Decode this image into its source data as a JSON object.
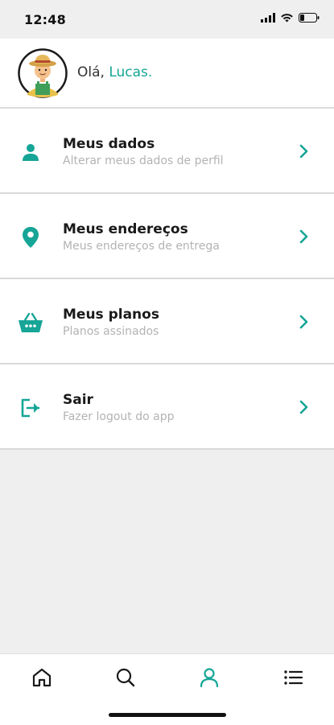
{
  "status_bar": {
    "time": "12:48"
  },
  "header": {
    "greeting": "Olá,",
    "user_name": "Lucas.",
    "avatar_icon": "farmer-avatar-icon"
  },
  "menu": {
    "items": [
      {
        "title": "Meus dados",
        "subtitle": "Alterar meus dados de perfil",
        "icon": "user-icon"
      },
      {
        "title": "Meus endereços",
        "subtitle": "Meus endereços de entrega",
        "icon": "location-pin-icon"
      },
      {
        "title": "Meus planos",
        "subtitle": "Planos assinados",
        "icon": "basket-icon"
      },
      {
        "title": "Sair",
        "subtitle": "Fazer logout do app",
        "icon": "logout-icon"
      }
    ]
  },
  "bottom_nav": {
    "items": [
      {
        "icon": "home-icon",
        "active": false
      },
      {
        "icon": "search-icon",
        "active": false
      },
      {
        "icon": "profile-icon",
        "active": true
      },
      {
        "icon": "list-icon",
        "active": false
      }
    ]
  },
  "colors": {
    "accent": "#16a596",
    "background": "#efefef",
    "card": "#ffffff",
    "subtitle": "#b3b3b3"
  }
}
